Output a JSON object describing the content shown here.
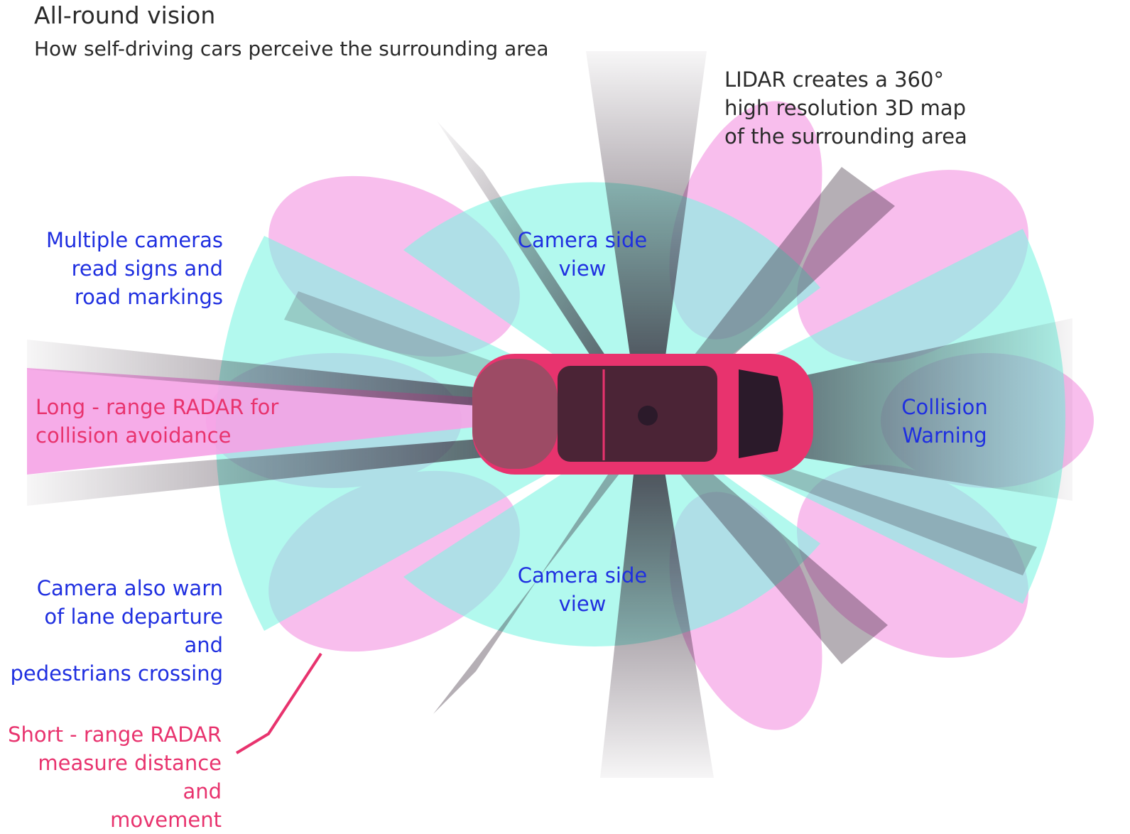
{
  "header": {
    "title": "All-round vision",
    "subtitle": "How self-driving cars perceive the surrounding area"
  },
  "labels": {
    "lidar": "LIDAR creates  a 360°\nhigh resolution 3D map\nof the surrounding area",
    "multiple_cameras": "Multiple cameras\nread signs and\nroad markings",
    "camera_side_top": "Camera side\nview",
    "camera_side_bottom": "Camera side\nview",
    "long_range_radar": "Long - range RADAR for\ncollision avoidance",
    "collision_warning": "Collision\nWarning",
    "camera_warn": "Camera also warn\nof lane departure and\npedestrians crossing",
    "short_range_radar": "Short  - range RADAR\nmeasure distance and\nmovement"
  },
  "colors": {
    "camera_zone": "#7ff5e3",
    "radar_zone": "#f5a3e6",
    "lidar_beam": "#2b1a2a",
    "car_body": "#e8336e",
    "blue_text": "#1f2fe0",
    "pink_text": "#e8336e",
    "dark_text": "#2a2a2a"
  }
}
